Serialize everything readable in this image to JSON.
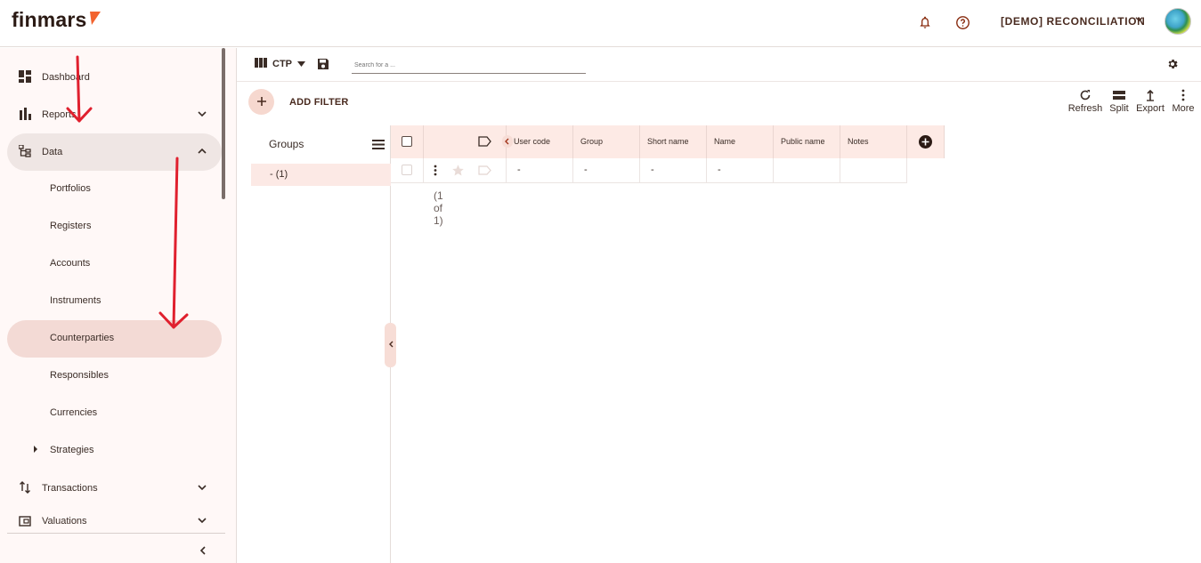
{
  "app": {
    "logo_text": "finmars"
  },
  "header": {
    "bell_icon": "bell-icon",
    "help_icon": "help-icon",
    "workspace_label": "[DEMO] RECONCILIATION",
    "chevron_icon": "chevron-down-icon",
    "avatar_icon": "globe-avatar"
  },
  "sidebar": {
    "items": [
      {
        "label": "Dashboard",
        "icon": "dashboard-icon"
      },
      {
        "label": "Reports",
        "icon": "bar-chart-icon"
      },
      {
        "label": "Data",
        "icon": "data-tree-icon"
      },
      {
        "label": "Transactions",
        "icon": "transactions-icon"
      },
      {
        "label": "Valuations",
        "icon": "wallet-icon"
      }
    ],
    "data_children": [
      {
        "label": "Portfolios"
      },
      {
        "label": "Registers"
      },
      {
        "label": "Accounts"
      },
      {
        "label": "Instruments"
      },
      {
        "label": "Counterparties"
      },
      {
        "label": "Responsibles"
      },
      {
        "label": "Currencies"
      },
      {
        "label": "Strategies"
      }
    ]
  },
  "toolbar": {
    "layout_name": "CTP",
    "search_placeholder": "Search for a ..."
  },
  "filterbar": {
    "add_filter_label": "ADD FILTER",
    "actions": [
      {
        "label": "Refresh",
        "icon": "refresh-icon"
      },
      {
        "label": "Split",
        "icon": "split-icon"
      },
      {
        "label": "Export",
        "icon": "export-icon"
      },
      {
        "label": "More",
        "icon": "more-vertical-icon"
      }
    ]
  },
  "groups": {
    "title": "Groups",
    "rows": [
      {
        "label": "- (1)"
      }
    ]
  },
  "table": {
    "columns": [
      "User code",
      "Group",
      "Short name",
      "Name",
      "Public name",
      "Notes"
    ],
    "rows": [
      {
        "cells": [
          "-",
          "-",
          "-",
          "-",
          "",
          ""
        ]
      }
    ],
    "pager": "(1 of 1)"
  },
  "colors": {
    "accent": "#f2632f",
    "sidebar_bg": "#fff8f7",
    "active_item": "#f3dad5",
    "header_row": "#fdeae5"
  }
}
